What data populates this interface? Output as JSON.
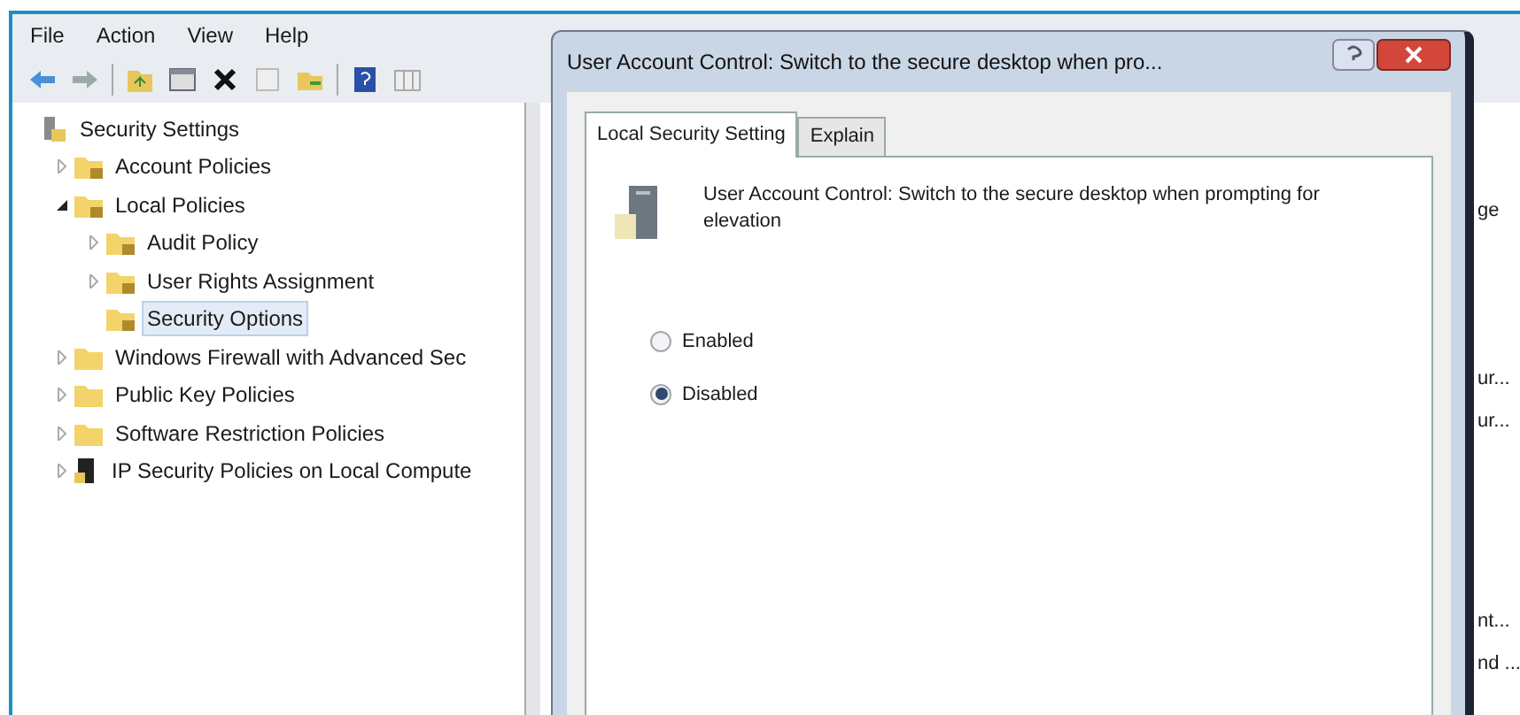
{
  "menu": [
    "File",
    "Action",
    "View",
    "Help"
  ],
  "tree": [
    {
      "label": "Security Settings",
      "kind": "root",
      "selected": false,
      "children": [
        {
          "label": "Account Policies",
          "kind": "folder",
          "expanded": false,
          "selected": false
        },
        {
          "label": "Local Policies",
          "kind": "folder",
          "expanded": true,
          "selected": false,
          "children": [
            {
              "label": "Audit Policy",
              "kind": "folder",
              "expanded": false,
              "selected": false
            },
            {
              "label": "User Rights Assignment",
              "kind": "folder",
              "expanded": false,
              "selected": false
            },
            {
              "label": "Security Options",
              "kind": "folder",
              "selected": true
            }
          ]
        },
        {
          "label": "Windows Firewall with Advanced Sec",
          "kind": "plain",
          "expanded": false,
          "selected": false
        },
        {
          "label": "Public Key Policies",
          "kind": "plain",
          "expanded": false,
          "selected": false
        },
        {
          "label": "Software Restriction Policies",
          "kind": "plain",
          "expanded": false,
          "selected": false
        },
        {
          "label": "IP Security Policies on Local Compute",
          "kind": "ipsec",
          "expanded": false,
          "selected": false
        }
      ]
    }
  ],
  "results_fragments": [
    "ge",
    "ur...",
    "ur...",
    "nt...",
    "nd ..."
  ],
  "dialog": {
    "title": "User Account Control: Switch to the secure desktop when pro...",
    "tabs": [
      {
        "label": "Local Security Setting",
        "selected": true
      },
      {
        "label": "Explain",
        "selected": false
      }
    ],
    "description": "User Account Control: Switch to the secure desktop when prompting for elevation",
    "options": [
      {
        "label": "Enabled",
        "selected": false
      },
      {
        "label": "Disabled",
        "selected": true
      }
    ]
  }
}
